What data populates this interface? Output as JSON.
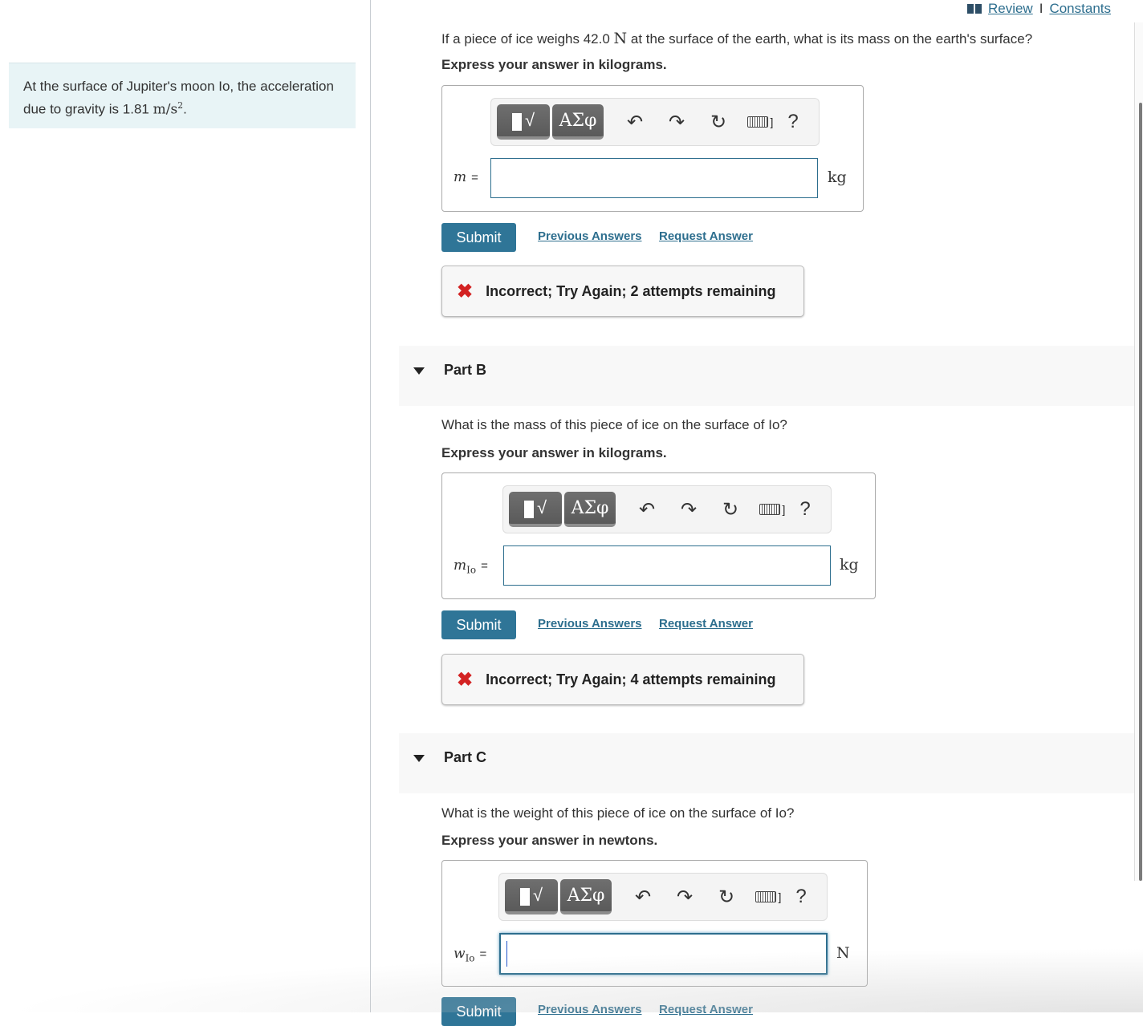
{
  "topnav": {
    "review": "Review",
    "separator": "I",
    "constants": "Constants"
  },
  "info": {
    "text": "At the surface of Jupiter's moon Io, the acceleration due to gravity is 1.81 ",
    "unit": "m/s",
    "exp": "2",
    "end": "."
  },
  "toolbar": {
    "templates_icon": "√",
    "greek": "ΑΣφ",
    "undo": "↶",
    "redo": "↷",
    "reset": "↻",
    "kbd_bracket": "]",
    "help": "?"
  },
  "common": {
    "submit": "Submit",
    "previous_answers": "Previous Answers",
    "request_answer": "Request Answer"
  },
  "partA": {
    "question_pre": "If a piece of ice weighs 42.0 ",
    "question_unit": "N",
    "question_post": " at the surface of the earth, what is its mass on the earth's surface?",
    "instruction": "Express your answer in kilograms.",
    "var": "m",
    "var_sub": "",
    "eq": "=",
    "unit": "kg",
    "value": "",
    "feedback": "Incorrect; Try Again; 2 attempts remaining"
  },
  "partB": {
    "title": "Part B",
    "question": "What is the mass of this piece of ice on the surface of Io?",
    "instruction": "Express your answer in kilograms.",
    "var": "m",
    "var_sub": "Io",
    "eq": "=",
    "unit": "kg",
    "value": "",
    "feedback": "Incorrect; Try Again; 4 attempts remaining"
  },
  "partC": {
    "title": "Part C",
    "question": "What is the weight of this piece of ice on the surface of Io?",
    "instruction": "Express your answer in newtons.",
    "var": "w",
    "var_sub": "Io",
    "eq": "=",
    "unit": "N",
    "value": ""
  }
}
